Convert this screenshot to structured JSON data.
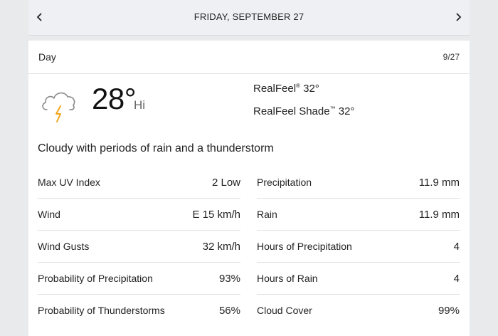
{
  "header": {
    "date_label": "FRIDAY, SEPTEMBER 27"
  },
  "card": {
    "title": "Day",
    "short_date": "9/27",
    "icon": "cloud-thunderstorm-icon",
    "temperature": "28°",
    "temp_suffix": "Hi",
    "realfeel_label": "RealFeel",
    "realfeel_value": "32°",
    "realfeel_shade_label": "RealFeel Shade",
    "realfeel_shade_value": "32°",
    "phrase": "Cloudy with periods of rain and a thunderstorm"
  },
  "details_left": [
    {
      "label": "Max UV Index",
      "value": "2 Low"
    },
    {
      "label": "Wind",
      "value": "E 15 km/h"
    },
    {
      "label": "Wind Gusts",
      "value": "32 km/h"
    },
    {
      "label": "Probability of Precipitation",
      "value": "93%"
    },
    {
      "label": "Probability of Thunderstorms",
      "value": "56%"
    }
  ],
  "details_right": [
    {
      "label": "Precipitation",
      "value": "11.9 mm"
    },
    {
      "label": "Rain",
      "value": "11.9 mm"
    },
    {
      "label": "Hours of Precipitation",
      "value": "4"
    },
    {
      "label": "Hours of Rain",
      "value": "4"
    },
    {
      "label": "Cloud Cover",
      "value": "99%"
    }
  ],
  "colors": {
    "bolt": "#f2a71b",
    "cloud_stroke": "#8a8a8a",
    "header_bg": "#eef0f4"
  }
}
